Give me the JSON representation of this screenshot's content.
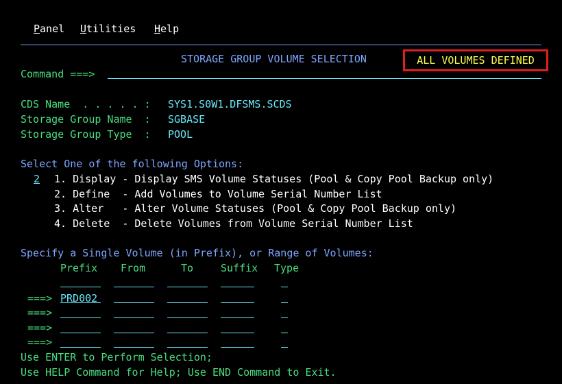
{
  "menu": {
    "panel": {
      "hot": "P",
      "rest": "anel"
    },
    "utilities": {
      "hot": "U",
      "rest": "tilities"
    },
    "help": {
      "hot": "H",
      "rest": "elp"
    }
  },
  "header": {
    "title": "STORAGE GROUP VOLUME SELECTION",
    "status": "ALL VOLUMES DEFINED"
  },
  "command": {
    "label": "Command ===>",
    "value": ""
  },
  "info": {
    "cds_label": "CDS Name  . . . . . :",
    "cds_value": "SYS1.S0W1.DFSMS.SCDS",
    "sg_name_label": "Storage Group Name  :",
    "sg_name_value": "SGBASE",
    "sg_type_label": "Storage Group Type  :",
    "sg_type_value": "POOL"
  },
  "options": {
    "heading": "Select One of the following Options:",
    "selected": "2",
    "items": [
      "1. Display - Display SMS Volume Statuses (Pool & Copy Pool Backup only)",
      "2. Define  - Add Volumes to Volume Serial Number List",
      "3. Alter   - Alter Volume Statuses (Pool & Copy Pool Backup only)",
      "4. Delete  - Delete Volumes from Volume Serial Number List"
    ]
  },
  "volumes": {
    "heading": "Specify a Single Volume (in Prefix), or Range of Volumes:",
    "columns": {
      "prefix": "Prefix",
      "from": "From",
      "to": "To",
      "suffix": "Suffix",
      "type": "Type"
    },
    "arrow": "===>",
    "rows": [
      {
        "prefix": "PRD002",
        "from": "",
        "to": "",
        "suffix": "",
        "type": ""
      },
      {
        "prefix": "",
        "from": "",
        "to": "",
        "suffix": "",
        "type": ""
      },
      {
        "prefix": "",
        "from": "",
        "to": "",
        "suffix": "",
        "type": ""
      },
      {
        "prefix": "",
        "from": "",
        "to": "",
        "suffix": "",
        "type": ""
      }
    ]
  },
  "footer": {
    "line1": "Use ENTER to Perform Selection;",
    "line2": "Use HELP Command for Help; Use END Command to Exit."
  },
  "colors": {
    "background": "#000000",
    "text_green": "#4ade80",
    "text_cyan": "#67e8f9",
    "text_blue": "#7ea6ff",
    "status_yellow": "#ffff4d",
    "highlight_border": "#e02020"
  }
}
